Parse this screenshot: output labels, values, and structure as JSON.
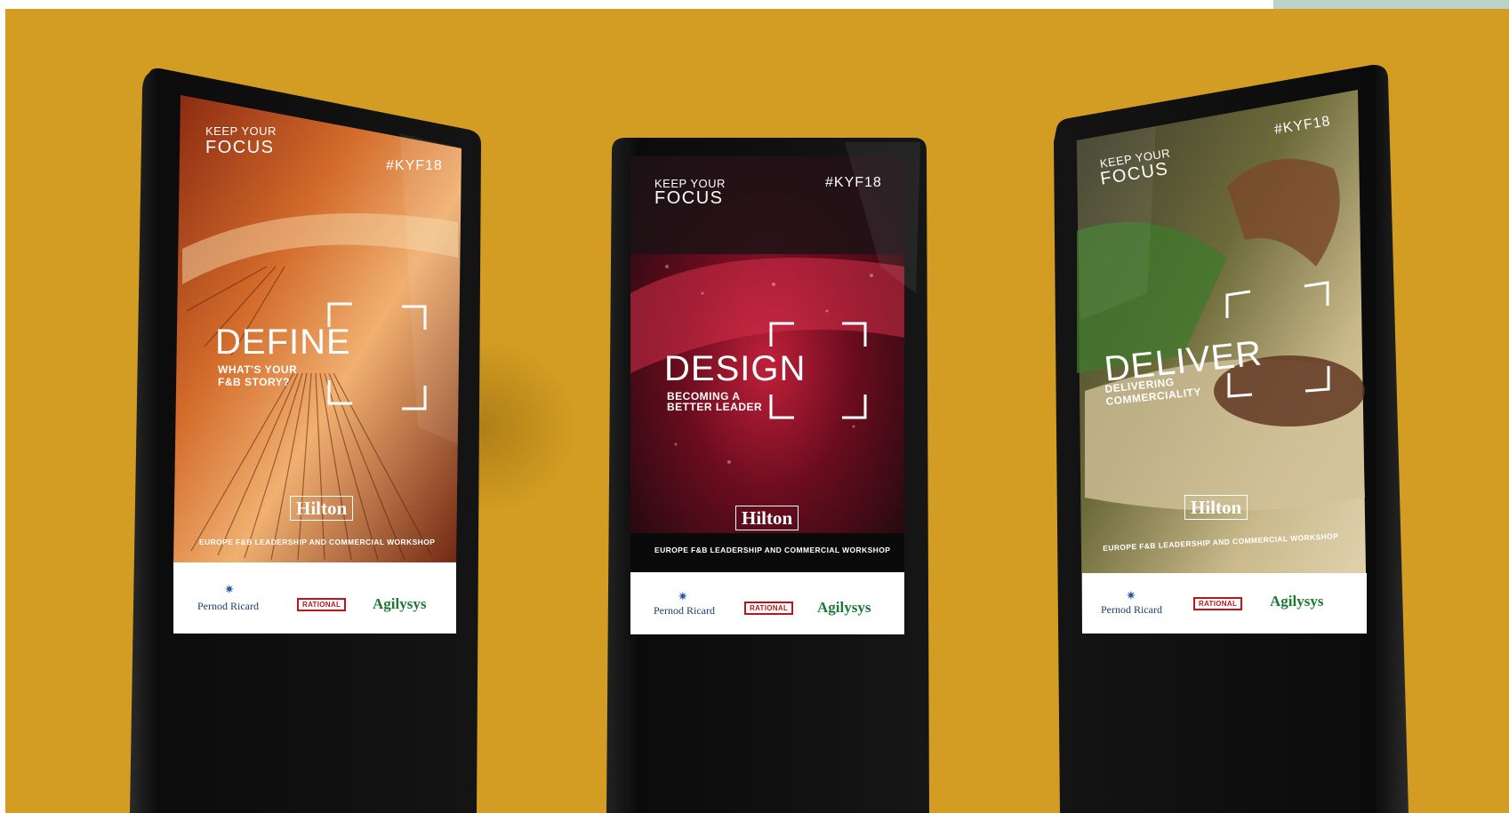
{
  "scene": "three digital signage kiosks on a mustard background",
  "colors": {
    "background": "#d29d22",
    "kiosk_body": "#0c0c0c",
    "headline_white": "#ffffff",
    "rational_red": "#c0141b",
    "agilysys_green": "#1c7a34",
    "pernod_blue": "#1e3a72"
  },
  "kiosks": [
    {
      "keep_your": "KEEP YOUR",
      "focus": "FOCUS",
      "hashtag": "#KYF18",
      "headline": "DEFINE",
      "sub_1": "WHAT'S YOUR",
      "sub_2": "F&B STORY?",
      "hilton": "Hilton",
      "workshop": "EUROPE F&B LEADERSHIP AND COMMERCIAL WORKSHOP",
      "sponsors": {
        "pernod": "Pernod Ricard",
        "rational": "RATIONAL",
        "agilysys": "Agilysys"
      }
    },
    {
      "keep_your": "KEEP YOUR",
      "focus": "FOCUS",
      "hashtag": "#KYF18",
      "headline": "DESIGN",
      "sub_1": "BECOMING A",
      "sub_2": "BETTER LEADER",
      "hilton": "Hilton",
      "workshop": "EUROPE F&B LEADERSHIP AND COMMERCIAL WORKSHOP",
      "sponsors": {
        "pernod": "Pernod Ricard",
        "rational": "RATIONAL",
        "agilysys": "Agilysys"
      }
    },
    {
      "keep_your": "KEEP YOUR",
      "focus": "FOCUS",
      "hashtag": "#KYF18",
      "headline": "DELIVER",
      "sub_1": "DELIVERING",
      "sub_2": "COMMERCIALITY",
      "hilton": "Hilton",
      "workshop": "EUROPE F&B LEADERSHIP AND COMMERCIAL WORKSHOP",
      "sponsors": {
        "pernod": "Pernod Ricard",
        "rational": "RATIONAL",
        "agilysys": "Agilysys"
      }
    }
  ]
}
